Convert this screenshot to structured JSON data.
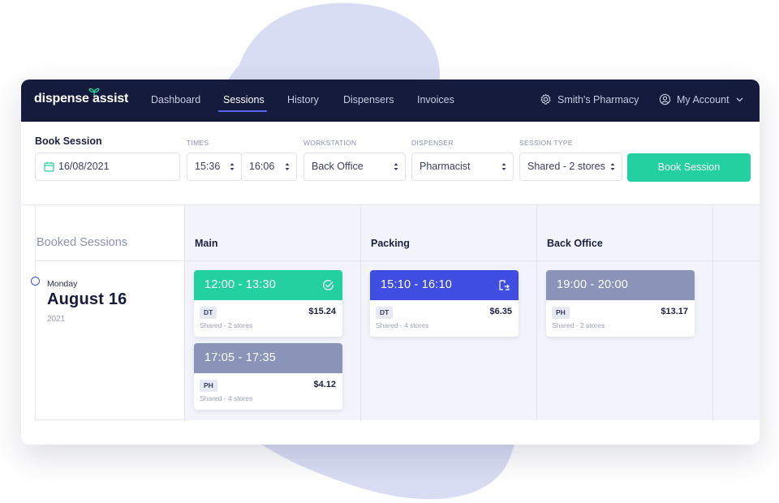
{
  "brand": {
    "logo_text": "dispense assist"
  },
  "nav": {
    "items": [
      {
        "label": "Dashboard",
        "active": false
      },
      {
        "label": "Sessions",
        "active": true
      },
      {
        "label": "History",
        "active": false
      },
      {
        "label": "Dispensers",
        "active": false
      },
      {
        "label": "Invoices",
        "active": false
      }
    ],
    "pharmacy": "Smith's Pharmacy",
    "account": "My Account",
    "pharmacy_icon": "gear-icon",
    "account_icon": "user-icon"
  },
  "form": {
    "title": "Book Session",
    "date": "16/08/2021",
    "times_label": "TIMES",
    "time_start": "15:36",
    "time_end": "16:06",
    "workstation_label": "WORKSTATION",
    "workstation": "Back Office",
    "dispenser_label": "DISPENSER",
    "dispenser": "Pharmacist",
    "session_type_label": "SESSION TYPE",
    "session_type": "Shared - 2 stores",
    "submit_label": "Book Session"
  },
  "booked": {
    "title": "Booked Sessions",
    "columns": [
      "Main",
      "Packing",
      "Back Office"
    ],
    "day": {
      "weekday": "Monday",
      "date": "August 16",
      "year": "2021"
    },
    "sessions": [
      {
        "time": "12:00 - 13:30",
        "code": "DT",
        "price": "$15.24",
        "type": "Shared - 2 stores",
        "color": "#23d1a0",
        "icon": "check-circle-icon"
      },
      {
        "time": "17:05 - 17:35",
        "code": "PH",
        "price": "$4.12",
        "type": "Shared - 4 stores",
        "color": "#8a93b8",
        "icon": ""
      },
      {
        "time": "15:10 - 16:10",
        "code": "DT",
        "price": "$6.35",
        "type": "Shared - 4 stores",
        "color": "#3f4de0",
        "icon": "swap-icon"
      },
      {
        "time": "19:00 - 20:00",
        "code": "PH",
        "price": "$13.17",
        "type": "Shared - 2 stores",
        "color": "#8a93b8",
        "icon": ""
      }
    ]
  },
  "colors": {
    "nav_bg": "#151b3d",
    "accent": "#23d1a0",
    "active_underline": "#5865f2",
    "blob": "#d9ddf3"
  }
}
